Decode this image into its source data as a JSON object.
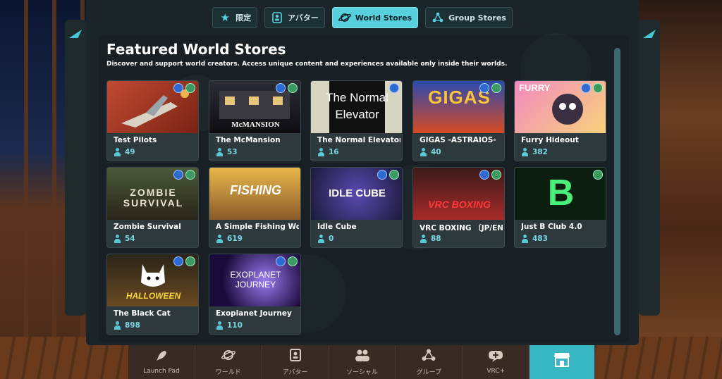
{
  "top_tabs": [
    {
      "label": "限定",
      "icon": "star-icon",
      "active": false
    },
    {
      "label": "アバター",
      "icon": "avatar-icon",
      "active": false
    },
    {
      "label": "World Stores",
      "icon": "world-icon",
      "active": true
    },
    {
      "label": "Group Stores",
      "icon": "group-icon",
      "active": false
    }
  ],
  "header": {
    "title": "Featured World Stores",
    "subtitle": "Discover and support world creators. Access unique content and experiences available only inside their worlds."
  },
  "worlds": [
    {
      "name": "Test Pilots",
      "count": "49",
      "thumb_text": "",
      "thumb_bg": "#b8422e"
    },
    {
      "name": "The McMansion",
      "count": "53",
      "thumb_text": "McMANSION",
      "thumb_bg": "#1a1a1e"
    },
    {
      "name": "The Normal Elevator",
      "count": "16",
      "thumb_text": "The Normal Elevator",
      "thumb_bg": "#222"
    },
    {
      "name": "GIGAS -ASTRAIOS-",
      "count": "40",
      "thumb_text": "GIGAS",
      "thumb_bg": "#2a3c8a"
    },
    {
      "name": "Furry Hideout",
      "count": "382",
      "thumb_text": "FURRY",
      "thumb_bg": "#e06aa8"
    },
    {
      "name": "Zombie Survival",
      "count": "54",
      "thumb_text": "ZOMBIE SURVIVAL",
      "thumb_bg": "#3a3a32"
    },
    {
      "name": "A Simple Fishing World",
      "count": "619",
      "thumb_text": "FISHING",
      "thumb_bg": "#d2a64a"
    },
    {
      "name": "Idle Cube",
      "count": "0",
      "thumb_text": "IDLE CUBE",
      "thumb_bg": "#2a2a5a"
    },
    {
      "name": "VRC BOXING 〔JP/EN〕",
      "count": "88",
      "thumb_text": "VRC BOXING",
      "thumb_bg": "#7a2222"
    },
    {
      "name": "Just B Club 4.0",
      "count": "483",
      "thumb_text": "B",
      "thumb_bg": "#0c2a14"
    },
    {
      "name": "The Black Cat",
      "count": "898",
      "thumb_text": "HALLOWEEN",
      "thumb_bg": "#3a2612"
    },
    {
      "name": "Exoplanet Journey",
      "count": "110",
      "thumb_text": "EXOPLANET JOURNEY",
      "thumb_bg": "#2a1a5a"
    }
  ],
  "bottom_nav": [
    {
      "label": "Launch Pad",
      "icon": "rocket-icon",
      "active": false
    },
    {
      "label": "ワールド",
      "icon": "planet-icon",
      "active": false
    },
    {
      "label": "アバター",
      "icon": "avatar-card-icon",
      "active": false
    },
    {
      "label": "ソーシャル",
      "icon": "people-icon",
      "active": false
    },
    {
      "label": "グループ",
      "icon": "group-icon",
      "active": false
    },
    {
      "label": "VRC+",
      "icon": "vrc-plus-icon",
      "active": false
    },
    {
      "label": "",
      "icon": "store-icon",
      "active": true
    }
  ],
  "colors": {
    "accent": "#56d0dd",
    "panel": "#1b2428",
    "card": "#2d393d"
  }
}
